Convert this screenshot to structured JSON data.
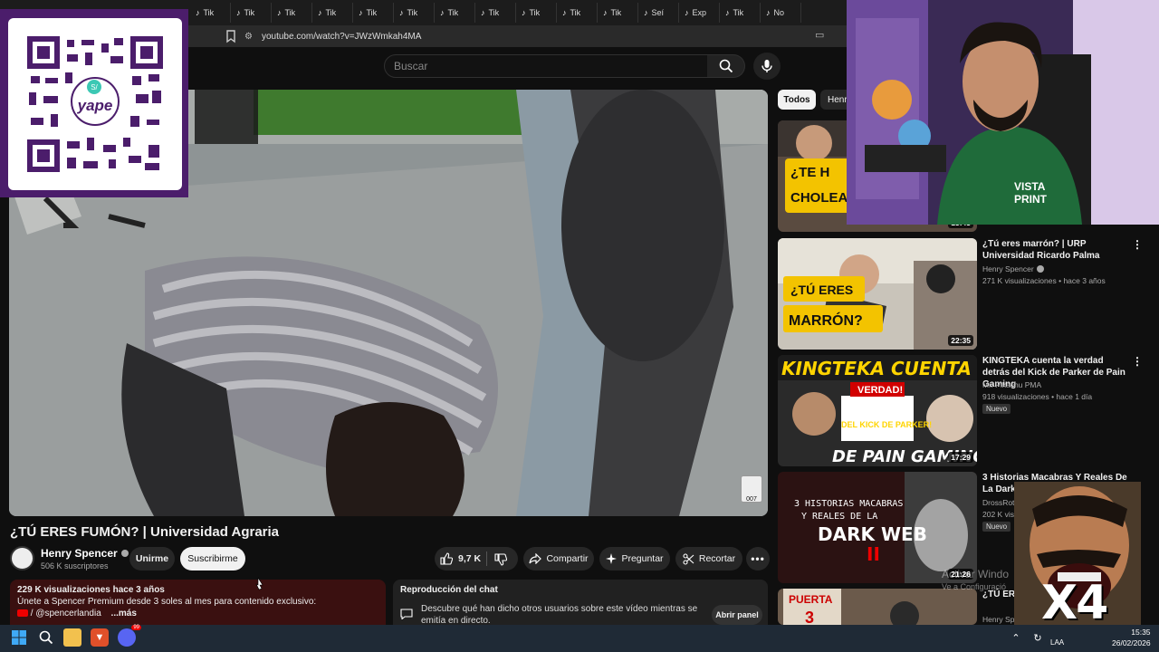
{
  "browser": {
    "tabs": [
      "Tik",
      "Tik",
      "Tik",
      "Tik",
      "Tik",
      "Tik",
      "Tik",
      "Tik",
      "Tik",
      "Tik",
      "Tik",
      "Seí",
      "Exp",
      "Tik",
      "No"
    ],
    "url": "youtube.com/watch?v=JWzWmkah4MA"
  },
  "youtube": {
    "search_placeholder": "Buscar",
    "video": {
      "title": "¿TÚ ERES FUMÓN? | Universidad Agraria",
      "watermark": "007"
    },
    "channel": {
      "name": "Henry Spencer",
      "subscribers": "506 K suscriptores",
      "join_label": "Unirme",
      "subscribe_label": "Suscribirme"
    },
    "actions": {
      "likes": "9,7 K",
      "share": "Compartir",
      "ask": "Preguntar",
      "clip": "Recortar"
    },
    "description": {
      "meta": "229 K visualizaciones  hace 3 años",
      "line1": "Únete a Spencer Premium desde 3 soles al mes para contenido exclusivo:",
      "line2": "/ @spencerlandia",
      "more": "...más"
    },
    "chat": {
      "title": "Reproducción del chat",
      "description": "Descubre qué han dicho otros usuarios sobre este vídeo mientras se emitía en directo.",
      "open_label": "Abrir panel"
    },
    "chips": {
      "all": "Todos",
      "henry": "Henr"
    },
    "recommendations": [
      {
        "thumb_text": [
          "¿TE H",
          "CHOLEA"
        ],
        "duration": "13:43",
        "title": "",
        "channel": "",
        "stats": ""
      },
      {
        "thumb_text": [
          "¿TÚ ERES",
          "MARRÓN?"
        ],
        "duration": "22:35",
        "title": "¿Tú eres marrón? | URP Universidad Ricardo Palma",
        "channel": "Henry Spencer",
        "stats": "271 K visualizaciones • hace 3 años"
      },
      {
        "thumb_text": [
          "KINGTEKA CUENTA LA",
          "VERDAD!",
          "DEL KICK DE PARKER!",
          "DE PAIN GAMING!"
        ],
        "duration": "17:29",
        "title": "KINGTEKA cuenta la verdad detrás del Kick de Parker de Pain Gaming",
        "channel": "Mr. Pikachu PMA",
        "stats": "918 visualizaciones • hace 1 día",
        "badge": "Nuevo"
      },
      {
        "thumb_text": [
          "3 HISTORIAS MACABRAS",
          "Y REALES DE LA",
          "DARK WEB",
          "II"
        ],
        "duration": "21:26",
        "title": "3 Historias Macabras Y Reales De La Dark Web",
        "channel": "DrossRotz",
        "stats": "202 K visu",
        "badge": "Nuevo"
      },
      {
        "thumb_text": [
          "PUERTA",
          "3"
        ],
        "duration": "",
        "title": "¿TÚ ERES SAN MARCOS",
        "channel": "Henry Spencer",
        "stats": ""
      }
    ]
  },
  "overlay": {
    "qr_brand": "yape",
    "meme_label": "X4",
    "activate_line1": "Activar Windo",
    "activate_line2": "Ve a Configuració"
  },
  "taskbar": {
    "lang": "LAA",
    "time": "15:35",
    "date": "26/02/2026",
    "discord_badge": "99"
  },
  "colors": {
    "yt_bg": "#0f0f0f",
    "pill": "#272727",
    "qr_purple": "#4b1d6b",
    "description_bg": "#3a1010"
  }
}
